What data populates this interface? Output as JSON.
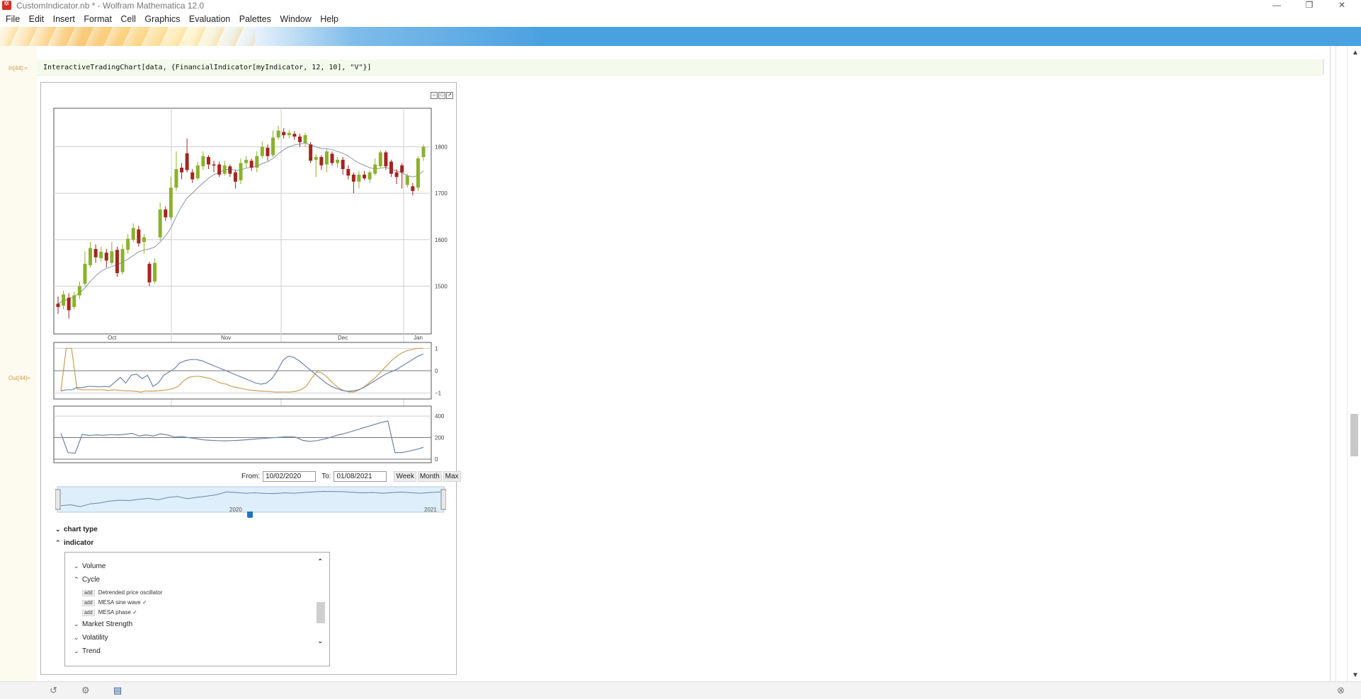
{
  "window": {
    "title": "CustomIndicator.nb * - Wolfram Mathematica 12.0",
    "controls": [
      "—",
      "❐",
      "✕"
    ]
  },
  "menu": [
    "File",
    "Edit",
    "Insert",
    "Format",
    "Cell",
    "Graphics",
    "Evaluation",
    "Palettes",
    "Window",
    "Help"
  ],
  "cell": {
    "in_label": "In[44]:=",
    "out_label": "Out[44]=",
    "code": "InteractiveTradingChart[data, {FinancialIndicator[myIndicator, 12, 10], \"V\"}]"
  },
  "range": {
    "from_label": "From:",
    "from_value": "10/02/2020",
    "to_label": "To:",
    "to_value": "01/08/2021",
    "buttons": [
      "Week",
      "Month",
      "Max"
    ],
    "slider_labels": [
      "2020",
      "2021"
    ]
  },
  "openers": {
    "chart_type": "chart type",
    "indicator": "indicator"
  },
  "indicator_list": {
    "volume": "Volume",
    "cycle": "Cycle",
    "add_label": "add",
    "items": [
      "Detrended price oscillator",
      "MESA sine wave ✓",
      "MESA phase ✓"
    ],
    "market_strength": "Market Strength",
    "volatility": "Volatility",
    "trend": "Trend"
  },
  "chart_data": [
    {
      "type": "candlestick",
      "x_tick_labels": [
        "Oct",
        "Nov",
        "Dec",
        "Jan"
      ],
      "y_tick_labels": [
        "1500",
        "1600",
        "1700",
        "1800"
      ],
      "ylim": [
        1400,
        1880
      ],
      "candles": [
        {
          "o": 1462,
          "c": 1455,
          "h": 1478,
          "l": 1440
        },
        {
          "o": 1458,
          "c": 1482,
          "h": 1490,
          "l": 1450
        },
        {
          "o": 1475,
          "c": 1448,
          "h": 1485,
          "l": 1430
        },
        {
          "o": 1455,
          "c": 1480,
          "h": 1488,
          "l": 1450
        },
        {
          "o": 1480,
          "c": 1500,
          "h": 1510,
          "l": 1472
        },
        {
          "o": 1505,
          "c": 1548,
          "h": 1575,
          "l": 1500
        },
        {
          "o": 1545,
          "c": 1582,
          "h": 1595,
          "l": 1540
        },
        {
          "o": 1580,
          "c": 1562,
          "h": 1590,
          "l": 1550
        },
        {
          "o": 1560,
          "c": 1574,
          "h": 1585,
          "l": 1552
        },
        {
          "o": 1572,
          "c": 1555,
          "h": 1580,
          "l": 1540
        },
        {
          "o": 1550,
          "c": 1575,
          "h": 1595,
          "l": 1545
        },
        {
          "o": 1578,
          "c": 1528,
          "h": 1585,
          "l": 1520
        },
        {
          "o": 1530,
          "c": 1580,
          "h": 1590,
          "l": 1525
        },
        {
          "o": 1578,
          "c": 1602,
          "h": 1612,
          "l": 1570
        },
        {
          "o": 1600,
          "c": 1625,
          "h": 1635,
          "l": 1595
        },
        {
          "o": 1622,
          "c": 1592,
          "h": 1630,
          "l": 1585
        },
        {
          "o": 1595,
          "c": 1605,
          "h": 1612,
          "l": 1570
        },
        {
          "o": 1548,
          "c": 1508,
          "h": 1552,
          "l": 1500
        },
        {
          "o": 1510,
          "c": 1550,
          "h": 1560,
          "l": 1505
        },
        {
          "o": 1605,
          "c": 1665,
          "h": 1680,
          "l": 1598
        },
        {
          "o": 1665,
          "c": 1648,
          "h": 1672,
          "l": 1640
        },
        {
          "o": 1648,
          "c": 1712,
          "h": 1735,
          "l": 1642
        },
        {
          "o": 1712,
          "c": 1752,
          "h": 1790,
          "l": 1705
        },
        {
          "o": 1755,
          "c": 1745,
          "h": 1765,
          "l": 1730
        },
        {
          "o": 1786,
          "c": 1750,
          "h": 1818,
          "l": 1745
        },
        {
          "o": 1745,
          "c": 1730,
          "h": 1752,
          "l": 1722
        },
        {
          "o": 1732,
          "c": 1760,
          "h": 1768,
          "l": 1728
        },
        {
          "o": 1758,
          "c": 1780,
          "h": 1790,
          "l": 1750
        },
        {
          "o": 1778,
          "c": 1762,
          "h": 1782,
          "l": 1752
        },
        {
          "o": 1762,
          "c": 1760,
          "h": 1770,
          "l": 1745
        },
        {
          "o": 1762,
          "c": 1740,
          "h": 1768,
          "l": 1735
        },
        {
          "o": 1742,
          "c": 1760,
          "h": 1770,
          "l": 1738
        },
        {
          "o": 1758,
          "c": 1742,
          "h": 1762,
          "l": 1735
        },
        {
          "o": 1745,
          "c": 1725,
          "h": 1750,
          "l": 1710
        },
        {
          "o": 1728,
          "c": 1765,
          "h": 1775,
          "l": 1720
        },
        {
          "o": 1765,
          "c": 1772,
          "h": 1780,
          "l": 1755
        },
        {
          "o": 1770,
          "c": 1755,
          "h": 1775,
          "l": 1748
        },
        {
          "o": 1755,
          "c": 1780,
          "h": 1790,
          "l": 1745
        },
        {
          "o": 1780,
          "c": 1800,
          "h": 1812,
          "l": 1775
        },
        {
          "o": 1798,
          "c": 1780,
          "h": 1805,
          "l": 1770
        },
        {
          "o": 1782,
          "c": 1820,
          "h": 1835,
          "l": 1778
        },
        {
          "o": 1820,
          "c": 1835,
          "h": 1845,
          "l": 1815
        },
        {
          "o": 1832,
          "c": 1825,
          "h": 1840,
          "l": 1818
        },
        {
          "o": 1825,
          "c": 1830,
          "h": 1836,
          "l": 1818
        },
        {
          "o": 1828,
          "c": 1822,
          "h": 1834,
          "l": 1815
        },
        {
          "o": 1822,
          "c": 1810,
          "h": 1828,
          "l": 1800
        },
        {
          "o": 1808,
          "c": 1825,
          "h": 1830,
          "l": 1800
        },
        {
          "o": 1805,
          "c": 1770,
          "h": 1810,
          "l": 1765
        },
        {
          "o": 1772,
          "c": 1778,
          "h": 1785,
          "l": 1735
        },
        {
          "o": 1778,
          "c": 1760,
          "h": 1782,
          "l": 1750
        },
        {
          "o": 1762,
          "c": 1790,
          "h": 1795,
          "l": 1745
        },
        {
          "o": 1785,
          "c": 1765,
          "h": 1790,
          "l": 1760
        },
        {
          "o": 1765,
          "c": 1772,
          "h": 1778,
          "l": 1755
        },
        {
          "o": 1772,
          "c": 1752,
          "h": 1778,
          "l": 1740
        },
        {
          "o": 1752,
          "c": 1738,
          "h": 1760,
          "l": 1730
        },
        {
          "o": 1740,
          "c": 1725,
          "h": 1745,
          "l": 1700
        },
        {
          "o": 1725,
          "c": 1740,
          "h": 1748,
          "l": 1710
        },
        {
          "o": 1740,
          "c": 1732,
          "h": 1748,
          "l": 1728
        },
        {
          "o": 1730,
          "c": 1745,
          "h": 1750,
          "l": 1722
        },
        {
          "o": 1742,
          "c": 1762,
          "h": 1775,
          "l": 1738
        },
        {
          "o": 1758,
          "c": 1788,
          "h": 1792,
          "l": 1755
        },
        {
          "o": 1788,
          "c": 1758,
          "h": 1792,
          "l": 1750
        },
        {
          "o": 1768,
          "c": 1742,
          "h": 1772,
          "l": 1735
        },
        {
          "o": 1745,
          "c": 1735,
          "h": 1752,
          "l": 1720
        },
        {
          "o": 1760,
          "c": 1745,
          "h": 1765,
          "l": 1710
        },
        {
          "o": 1718,
          "c": 1738,
          "h": 1742,
          "l": 1712
        },
        {
          "o": 1715,
          "c": 1705,
          "h": 1722,
          "l": 1695
        },
        {
          "o": 1712,
          "c": 1775,
          "h": 1780,
          "l": 1705
        },
        {
          "o": 1778,
          "c": 1800,
          "h": 1805,
          "l": 1770
        }
      ],
      "ma_line": [
        1462,
        1468,
        1472,
        1478,
        1485,
        1496,
        1510,
        1522,
        1532,
        1538,
        1542,
        1546,
        1552,
        1558,
        1566,
        1574,
        1578,
        1580,
        1584,
        1595,
        1608,
        1625,
        1650,
        1672,
        1690,
        1700,
        1712,
        1722,
        1732,
        1740,
        1745,
        1750,
        1752,
        1750,
        1750,
        1754,
        1756,
        1758,
        1764,
        1768,
        1775,
        1785,
        1794,
        1800,
        1804,
        1806,
        1808,
        1804,
        1800,
        1796,
        1796,
        1794,
        1790,
        1786,
        1780,
        1772,
        1765,
        1760,
        1755,
        1752,
        1754,
        1756,
        1752,
        1748,
        1744,
        1738,
        1735,
        1738,
        1748
      ]
    },
    {
      "type": "line",
      "title": "MESA sine wave",
      "y_tick_labels": [
        "−1",
        "0",
        "1"
      ],
      "ylim": [
        -1.2,
        1.2
      ],
      "series": [
        {
          "name": "",
          "color": "#c9a059",
          "values": [
            -0.9,
            1,
            1,
            -0.8,
            -0.85,
            -0.85,
            -0.85,
            -0.85,
            -0.85,
            -0.88,
            -0.85,
            -0.88,
            -0.9,
            -0.9,
            -0.92,
            -0.95,
            -0.9,
            -0.92,
            -0.9,
            -0.88,
            -0.85,
            -0.8,
            -0.7,
            -0.45,
            -0.3,
            -0.25,
            -0.25,
            -0.3,
            -0.35,
            -0.45,
            -0.55,
            -0.6,
            -0.7,
            -0.75,
            -0.8,
            -0.85,
            -0.88,
            -0.9,
            -0.92,
            -0.92,
            -0.95,
            -0.95,
            -0.95,
            -0.95,
            -0.92,
            -0.85,
            -0.7,
            -0.35,
            -0.05,
            -0.1,
            -0.3,
            -0.55,
            -0.75,
            -0.88,
            -0.95,
            -0.95,
            -0.85,
            -0.7,
            -0.5,
            -0.3,
            -0.05,
            0.2,
            0.45,
            0.65,
            0.8,
            0.9,
            0.95,
            1,
            1
          ]
        },
        {
          "name": "",
          "color": "#6f84a6",
          "values": [
            -0.9,
            -0.85,
            -0.85,
            -0.75,
            -0.75,
            -0.7,
            -0.7,
            -0.72,
            -0.7,
            -0.72,
            -0.5,
            -0.3,
            -0.55,
            -0.2,
            -0.15,
            -0.35,
            -0.2,
            -0.7,
            -0.55,
            -0.2,
            -0.05,
            0.1,
            0.35,
            0.45,
            0.5,
            0.5,
            0.45,
            0.35,
            0.25,
            0.15,
            0.05,
            -0.05,
            -0.15,
            -0.25,
            -0.35,
            -0.45,
            -0.55,
            -0.6,
            -0.55,
            -0.35,
            0,
            0.45,
            0.65,
            0.6,
            0.45,
            0.25,
            0.05,
            -0.15,
            -0.35,
            -0.55,
            -0.7,
            -0.8,
            -0.88,
            -0.92,
            -0.9,
            -0.85,
            -0.75,
            -0.6,
            -0.45,
            -0.3,
            -0.15,
            -0.05,
            0.05,
            0.2,
            0.35,
            0.5,
            0.65,
            0.75
          ]
        }
      ]
    },
    {
      "type": "line",
      "title": "MESA phase",
      "y_tick_labels": [
        "0",
        "200",
        "400"
      ],
      "ylim": [
        -20,
        480
      ],
      "series": [
        {
          "name": "",
          "color": "#6f84a6",
          "values": [
            240,
            60,
            55,
            230,
            220,
            225,
            222,
            228,
            225,
            230,
            240,
            215,
            225,
            215,
            235,
            225,
            205,
            210,
            200,
            190,
            180,
            175,
            172,
            170,
            172,
            175,
            180,
            185,
            190,
            195,
            200,
            205,
            210,
            205,
            175,
            165,
            172,
            185,
            205,
            225,
            240,
            260,
            280,
            300,
            320,
            340,
            355,
            60,
            62,
            75,
            90,
            110
          ]
        }
      ]
    }
  ],
  "navigator": {
    "values": [
      0.2,
      0.25,
      0.15,
      0.3,
      0.35,
      0.45,
      0.5,
      0.48,
      0.55,
      0.6,
      0.52,
      0.65,
      0.7,
      0.58,
      0.66,
      0.72,
      0.8,
      0.95,
      0.92,
      0.88,
      0.9,
      0.87,
      0.86,
      0.9,
      0.88,
      0.92,
      0.95,
      0.98,
      0.97,
      0.96,
      0.93,
      0.9,
      0.92,
      0.88,
      0.91,
      0.94,
      0.9,
      0.88,
      0.92,
      0.95
    ]
  }
}
